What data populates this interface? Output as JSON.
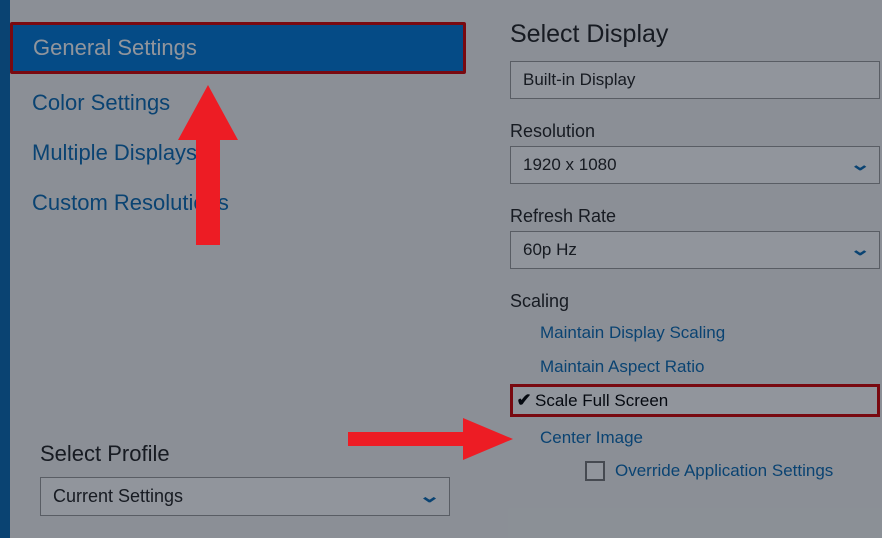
{
  "sidebar": {
    "items": [
      {
        "label": "General Settings",
        "selected": true
      },
      {
        "label": "Color Settings"
      },
      {
        "label": "Multiple Displays"
      },
      {
        "label": "Custom Resolutions"
      }
    ]
  },
  "profile": {
    "title": "Select Profile",
    "value": "Current Settings"
  },
  "main": {
    "select_display": {
      "title": "Select Display",
      "value": "Built-in Display"
    },
    "resolution": {
      "title": "Resolution",
      "value": "1920 x 1080"
    },
    "refresh": {
      "title": "Refresh Rate",
      "value": "60p Hz"
    },
    "scaling": {
      "title": "Scaling",
      "options": [
        "Maintain Display Scaling",
        "Maintain Aspect Ratio",
        "Scale Full Screen",
        "Center Image"
      ],
      "override": "Override Application Settings"
    }
  }
}
